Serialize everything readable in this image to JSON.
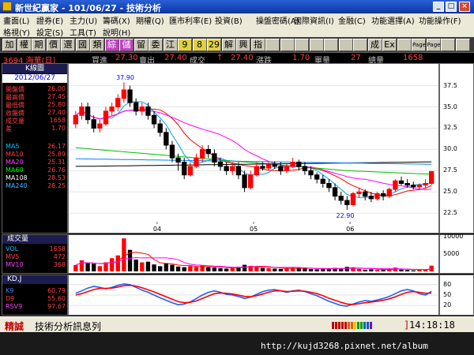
{
  "window": {
    "title": "新世紀贏家 - 101/06/27 - 技術分析",
    "min_label": "_",
    "max_label": "□",
    "close_label": "×"
  },
  "menu": {
    "row1": [
      "畫面(L)",
      "證券(E)",
      "主力(U)",
      "籌碼(X)",
      "期權(Q)",
      "匯市利率(E)",
      "投資(B)",
      "操盤密碼(A)",
      "國際資訊(I)",
      "金融(C)",
      "功能選擇(A)",
      "功能操作(F)"
    ],
    "row2": [
      "格視(Y)",
      "設定(S)",
      "工具(T)",
      "說明(H)"
    ]
  },
  "toolbar": {
    "buttons": [
      "加",
      "權",
      "期",
      "價",
      "選",
      "國",
      "類",
      "綜",
      "儲",
      "留",
      "委",
      "江",
      "9",
      "8",
      "29",
      "解",
      "興",
      "指",
      "",
      "",
      "",
      "",
      "",
      "",
      "",
      "成",
      "Ex",
      "",
      "Page",
      "Page",
      "",
      ""
    ]
  },
  "quote": {
    "code_name": "3694 海華(日)",
    "buy_label": "買進",
    "buy_value": "27.30",
    "sell_label": "賣出",
    "sell_value": "27.40",
    "last_label": "成交",
    "arrow": "↑",
    "last_value": "27.40",
    "change_label": "漲跌",
    "change_value": "1.70",
    "unit_label": "單量",
    "unit_value": "27",
    "total_label": "總量",
    "total_value": "1658"
  },
  "kpanel": {
    "title": "K線圖",
    "date": "2012/06/27",
    "rows": [
      {
        "label": "開盤價",
        "value": "26.00",
        "color": "#ff4040"
      },
      {
        "label": "最高價",
        "value": "27.45",
        "color": "#ff4040"
      },
      {
        "label": "最低價",
        "value": "25.80",
        "color": "#ff4040"
      },
      {
        "label": "收盤價",
        "value": "27.40",
        "color": "#ff4040"
      },
      {
        "label": "成交量",
        "value": "1658",
        "color": "#ff4040"
      },
      {
        "label": "差",
        "value": "1.70",
        "color": "#ff4040"
      }
    ],
    "ma": [
      {
        "label": "MA5",
        "value": "26.17",
        "color": "#00c0ff"
      },
      {
        "label": "MA10",
        "value": "25.89",
        "color": "#ff4040"
      },
      {
        "label": "MA20",
        "value": "25.31",
        "color": "#ff40ff"
      },
      {
        "label": "MA60",
        "value": "26.76",
        "color": "#00ff00"
      },
      {
        "label": "MA108",
        "value": "28.53",
        "color": "#ffffff"
      },
      {
        "label": "MA240",
        "value": "28.25",
        "color": "#40c0ff"
      }
    ]
  },
  "vpanel": {
    "title": "成交量",
    "rows": [
      {
        "label": "VOL",
        "value": "1658",
        "color": "#00c0ff"
      },
      {
        "label": "MV5",
        "value": "472",
        "color": "#ff4040"
      },
      {
        "label": "MV10",
        "value": "368",
        "color": "#ff40ff"
      }
    ]
  },
  "kdpanel": {
    "title": "KD,J",
    "rows": [
      {
        "label": "K9",
        "value": "60.79",
        "color": "#4080ff"
      },
      {
        "label": "D9",
        "value": "55.60",
        "color": "#ff4040"
      },
      {
        "label": "RSV9",
        "value": "97.67",
        "color": "#ff40ff"
      }
    ]
  },
  "chart_data": [
    {
      "type": "candlestick",
      "title": "K線圖",
      "ylim": [
        21.5,
        39.5
      ],
      "yticks": [
        22.5,
        25.0,
        27.5,
        30.0,
        32.5,
        35.0,
        37.5
      ],
      "x_tick_labels": [
        "04",
        "05",
        "06"
      ],
      "annotations": [
        "37.90",
        "22.90"
      ],
      "ohlc": [
        [
          33.0,
          34.5,
          32.5,
          34.0
        ],
        [
          34.0,
          35.5,
          33.5,
          35.0
        ],
        [
          35.0,
          35.5,
          33.0,
          33.5
        ],
        [
          33.5,
          34.0,
          32.0,
          32.5
        ],
        [
          32.5,
          33.5,
          32.0,
          33.0
        ],
        [
          33.0,
          35.0,
          32.8,
          34.5
        ],
        [
          34.5,
          35.5,
          34.0,
          35.0
        ],
        [
          35.0,
          36.5,
          34.5,
          36.0
        ],
        [
          36.0,
          37.9,
          35.5,
          37.0
        ],
        [
          37.0,
          37.5,
          35.0,
          35.5
        ],
        [
          35.5,
          36.0,
          34.0,
          34.5
        ],
        [
          34.5,
          35.5,
          34.0,
          35.0
        ],
        [
          35.0,
          35.5,
          33.5,
          34.0
        ],
        [
          34.0,
          34.5,
          32.5,
          33.0
        ],
        [
          33.0,
          33.5,
          31.5,
          32.0
        ],
        [
          32.0,
          32.5,
          30.0,
          30.5
        ],
        [
          30.5,
          31.0,
          28.5,
          29.0
        ],
        [
          29.0,
          29.5,
          27.5,
          28.5
        ],
        [
          28.5,
          29.0,
          26.5,
          27.0
        ],
        [
          27.0,
          28.5,
          26.8,
          28.0
        ],
        [
          28.0,
          29.5,
          27.8,
          29.0
        ],
        [
          29.0,
          30.5,
          28.5,
          30.0
        ],
        [
          30.0,
          30.5,
          29.0,
          29.5
        ],
        [
          29.5,
          30.0,
          28.0,
          28.5
        ],
        [
          28.5,
          29.0,
          27.5,
          28.0
        ],
        [
          28.0,
          28.5,
          27.0,
          27.5
        ],
        [
          27.5,
          28.5,
          27.0,
          28.0
        ],
        [
          28.0,
          28.5,
          26.5,
          27.0
        ],
        [
          27.0,
          27.5,
          25.0,
          25.5
        ],
        [
          25.5,
          27.5,
          25.3,
          27.0
        ],
        [
          27.0,
          28.5,
          26.8,
          28.0
        ],
        [
          28.0,
          28.5,
          27.5,
          27.8
        ],
        [
          27.8,
          28.5,
          27.5,
          28.2
        ],
        [
          28.2,
          28.6,
          27.7,
          28.0
        ],
        [
          28.0,
          28.5,
          27.0,
          27.5
        ],
        [
          27.5,
          28.3,
          27.2,
          28.0
        ],
        [
          28.0,
          29.0,
          27.8,
          28.5
        ],
        [
          28.5,
          28.8,
          27.5,
          28.0
        ],
        [
          28.0,
          28.5,
          27.0,
          27.5
        ],
        [
          27.5,
          28.0,
          26.5,
          27.0
        ],
        [
          27.0,
          27.3,
          26.0,
          26.5
        ],
        [
          26.5,
          27.0,
          25.5,
          26.0
        ],
        [
          26.0,
          26.5,
          25.0,
          25.5
        ],
        [
          25.5,
          26.0,
          24.0,
          24.5
        ],
        [
          24.5,
          25.0,
          23.5,
          24.0
        ],
        [
          24.0,
          24.5,
          22.9,
          23.5
        ],
        [
          23.5,
          25.0,
          23.3,
          24.8
        ],
        [
          24.8,
          25.5,
          24.3,
          25.0
        ],
        [
          25.0,
          25.3,
          24.0,
          24.5
        ],
        [
          24.5,
          25.0,
          23.8,
          24.2
        ],
        [
          24.2,
          25.0,
          24.0,
          24.8
        ],
        [
          24.8,
          25.2,
          24.0,
          24.5
        ],
        [
          24.5,
          25.5,
          24.3,
          25.3
        ],
        [
          25.3,
          26.5,
          25.0,
          26.3
        ],
        [
          26.3,
          26.8,
          25.8,
          26.0
        ],
        [
          26.0,
          26.5,
          25.5,
          25.8
        ],
        [
          25.8,
          26.2,
          25.3,
          25.6
        ],
        [
          25.6,
          26.0,
          25.2,
          25.8
        ],
        [
          25.8,
          26.5,
          25.5,
          26.0
        ],
        [
          26.0,
          27.45,
          25.8,
          27.4
        ]
      ],
      "ma_series": [
        {
          "name": "MA5",
          "color": "#00a0ff"
        },
        {
          "name": "MA10",
          "color": "#ff0000"
        },
        {
          "name": "MA20",
          "color": "#ff00ff"
        },
        {
          "name": "MA60",
          "color": "#00c000"
        },
        {
          "name": "MA108",
          "color": "#000000"
        },
        {
          "name": "MA240",
          "color": "#0080ff"
        }
      ]
    },
    {
      "type": "bar",
      "title": "成交量",
      "ylim": [
        0,
        10000
      ],
      "yticks": [
        5000,
        10000
      ],
      "values": [
        1800,
        3200,
        2400,
        2200,
        1500,
        2600,
        3800,
        4600,
        9500,
        6200,
        3400,
        2600,
        2800,
        2000,
        1500,
        2400,
        1900,
        1400,
        1200,
        1500,
        1300,
        1700,
        1200,
        1100,
        900,
        800,
        1000,
        1300,
        1900,
        1600,
        1400,
        1000,
        900,
        800,
        700,
        1000,
        1100,
        900,
        800,
        700,
        600,
        900,
        800,
        1000,
        700,
        1300,
        1200,
        700,
        500,
        600,
        500,
        400,
        700,
        1100,
        500,
        400,
        300,
        500,
        600,
        1658
      ]
    },
    {
      "type": "line",
      "title": "KD,J",
      "ylim": [
        0,
        100
      ],
      "yticks": [
        20,
        50,
        80
      ],
      "series": [
        {
          "name": "K9",
          "color": "#2060ff",
          "values": [
            55,
            62,
            70,
            75,
            72,
            68,
            72,
            78,
            82,
            80,
            72,
            64,
            58,
            50,
            42,
            35,
            28,
            22,
            24,
            30,
            40,
            50,
            58,
            62,
            58,
            52,
            50,
            46,
            40,
            44,
            52,
            60,
            64,
            66,
            62,
            58,
            62,
            64,
            60,
            54,
            48,
            40,
            32,
            26,
            20,
            18,
            24,
            30,
            34,
            32,
            36,
            40,
            46,
            54,
            62,
            66,
            62,
            54,
            50,
            60.79
          ]
        },
        {
          "name": "D9",
          "color": "#ff0000",
          "values": [
            50,
            54,
            60,
            66,
            69,
            69,
            70,
            73,
            77,
            78,
            76,
            71,
            65,
            59,
            52,
            45,
            38,
            31,
            28,
            29,
            33,
            40,
            47,
            54,
            56,
            55,
            53,
            50,
            46,
            45,
            48,
            53,
            58,
            62,
            62,
            60,
            61,
            62,
            61,
            58,
            54,
            48,
            41,
            35,
            29,
            24,
            23,
            25,
            28,
            30,
            32,
            35,
            39,
            45,
            52,
            58,
            60,
            58,
            55,
            55.6
          ]
        }
      ]
    }
  ],
  "status": {
    "brand": "精誠",
    "text": "技術分析訊息列",
    "time": "14:18:18",
    "bracket": "]"
  },
  "footer": {
    "watermark": "http://kujd3268.pixnet.net/album"
  }
}
